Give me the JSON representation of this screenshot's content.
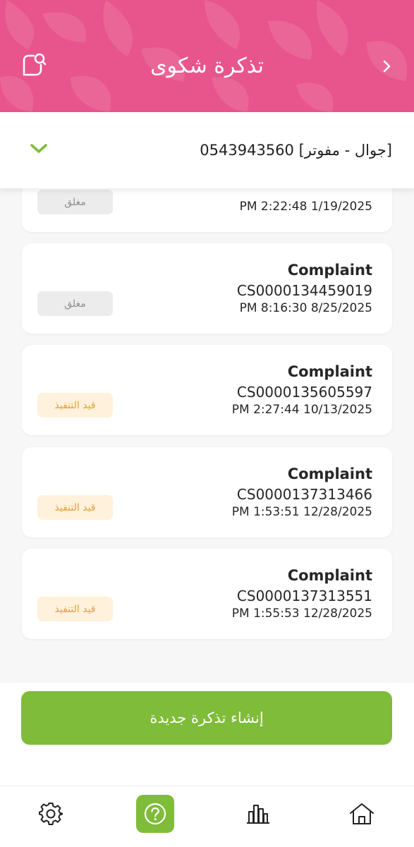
{
  "header": {
    "title": "تذكرة شكوى",
    "back_icon": "chevron-right-icon",
    "chat_icon": "chat-search-icon",
    "background_color": "#e8558c"
  },
  "account": {
    "selected": "0543943560   [جوال - مفوتر]",
    "dropdown_icon": "chevron-down-icon",
    "accent_color": "#7fbc3a"
  },
  "tickets": [
    {
      "type": "",
      "code": "",
      "date": "PM 2:22:48 1/19/2025",
      "status": "مغلق",
      "status_kind": "closed"
    },
    {
      "type": "Complaint",
      "code": "CS0000134459019",
      "date": "PM 8:16:30 8/25/2025",
      "status": "مغلق",
      "status_kind": "closed"
    },
    {
      "type": "Complaint",
      "code": "CS0000135605597",
      "date": "PM 2:27:44 10/13/2025",
      "status": "قيد التنفيذ",
      "status_kind": "progress"
    },
    {
      "type": "Complaint",
      "code": "CS0000137313466",
      "date": "PM 1:53:51 12/28/2025",
      "status": "قيد التنفيذ",
      "status_kind": "progress"
    },
    {
      "type": "Complaint",
      "code": "CS0000137313551",
      "date": "PM 1:55:53 12/28/2025",
      "status": "قيد التنفيذ",
      "status_kind": "progress"
    }
  ],
  "create_button": {
    "label": "إنشاء تذكرة جديدة",
    "color": "#7fbc3a"
  },
  "tabbar": {
    "items": [
      {
        "name": "settings",
        "icon": "gear-icon",
        "active": false
      },
      {
        "name": "help",
        "icon": "help-circle-icon",
        "active": true
      },
      {
        "name": "usage",
        "icon": "bar-chart-icon",
        "active": false
      },
      {
        "name": "home",
        "icon": "home-icon",
        "active": false
      }
    ]
  }
}
